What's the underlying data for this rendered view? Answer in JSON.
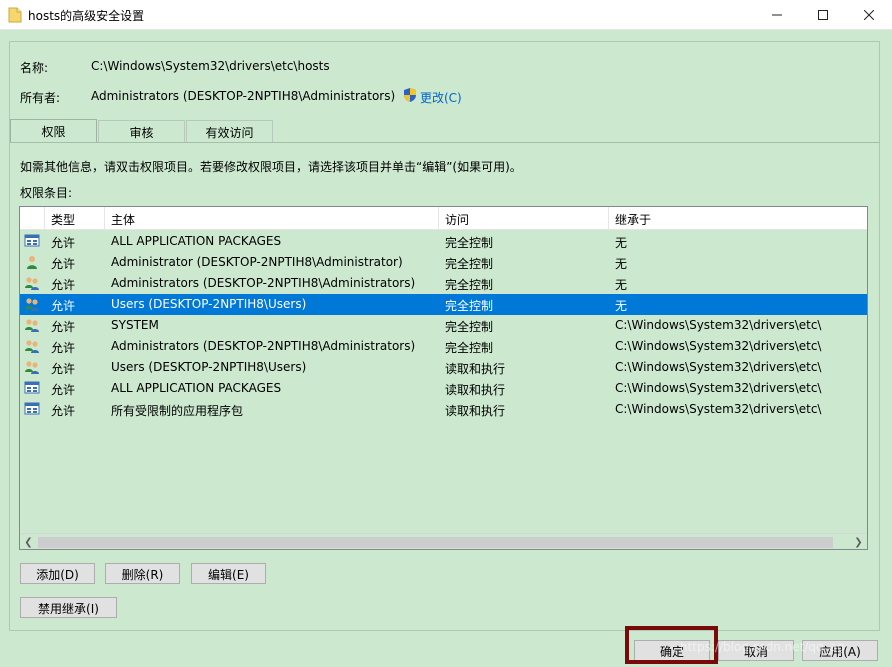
{
  "window": {
    "title": "hosts的高级安全设置"
  },
  "info": {
    "name_label": "名称:",
    "name_value": "C:\\Windows\\System32\\drivers\\etc\\hosts",
    "owner_label": "所有者:",
    "owner_value": "Administrators (DESKTOP-2NPTIH8\\Administrators)",
    "change_link": "更改(C)"
  },
  "tabs": [
    {
      "label": "权限",
      "active": true
    },
    {
      "label": "审核",
      "active": false
    },
    {
      "label": "有效访问",
      "active": false
    }
  ],
  "hint": "如需其他信息，请双击权限项目。若要修改权限项目，请选择该项目并单击“编辑”(如果可用)。",
  "entries_label": "权限条目:",
  "table": {
    "columns": [
      "类型",
      "主体",
      "访问",
      "继承于"
    ],
    "rows": [
      {
        "icon": "app-package-icon",
        "type": "允许",
        "principal": "ALL APPLICATION PACKAGES",
        "access": "完全控制",
        "inherited": "无"
      },
      {
        "icon": "user-icon",
        "type": "允许",
        "principal": "Administrator (DESKTOP-2NPTIH8\\Administrator)",
        "access": "完全控制",
        "inherited": "无"
      },
      {
        "icon": "group-icon",
        "type": "允许",
        "principal": "Administrators (DESKTOP-2NPTIH8\\Administrators)",
        "access": "完全控制",
        "inherited": "无"
      },
      {
        "icon": "group-icon",
        "type": "允许",
        "principal": "Users (DESKTOP-2NPTIH8\\Users)",
        "access": "完全控制",
        "inherited": "无",
        "selected": true
      },
      {
        "icon": "group-icon",
        "type": "允许",
        "principal": "SYSTEM",
        "access": "完全控制",
        "inherited": "C:\\Windows\\System32\\drivers\\etc\\"
      },
      {
        "icon": "group-icon",
        "type": "允许",
        "principal": "Administrators (DESKTOP-2NPTIH8\\Administrators)",
        "access": "完全控制",
        "inherited": "C:\\Windows\\System32\\drivers\\etc\\"
      },
      {
        "icon": "group-icon",
        "type": "允许",
        "principal": "Users (DESKTOP-2NPTIH8\\Users)",
        "access": "读取和执行",
        "inherited": "C:\\Windows\\System32\\drivers\\etc\\"
      },
      {
        "icon": "app-package-icon",
        "type": "允许",
        "principal": "ALL APPLICATION PACKAGES",
        "access": "读取和执行",
        "inherited": "C:\\Windows\\System32\\drivers\\etc\\"
      },
      {
        "icon": "app-package-icon",
        "type": "允许",
        "principal": "所有受限制的应用程序包",
        "access": "读取和执行",
        "inherited": "C:\\Windows\\System32\\drivers\\etc\\"
      }
    ]
  },
  "buttons": {
    "add": "添加(D)",
    "remove": "删除(R)",
    "edit": "编辑(E)",
    "disable_inheritance": "禁用继承(I)",
    "ok": "确定",
    "cancel": "取消",
    "apply": "应用(A)"
  },
  "watermark": "https://blog.csdn.net/qq_ag",
  "colors": {
    "background": "#cce8cf",
    "selection": "#0078d7",
    "link": "#0066cc",
    "highlight_box": "#7a0a0a"
  }
}
